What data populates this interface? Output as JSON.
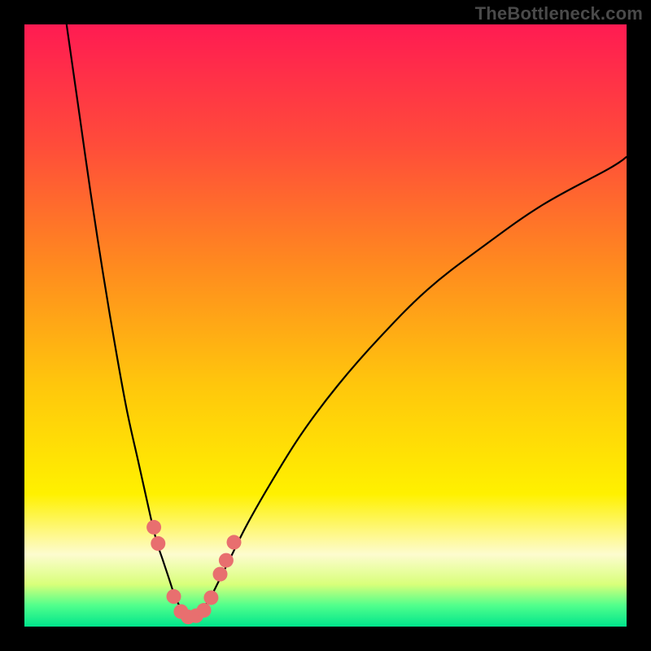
{
  "watermark": "TheBottleneck.com",
  "chart_data": {
    "type": "line",
    "title": "",
    "xlabel": "",
    "ylabel": "",
    "xlim": [
      0,
      100
    ],
    "ylim": [
      0,
      100
    ],
    "minimum_x": 27,
    "green_band": {
      "y0": 0,
      "y1": 4
    },
    "pale_yellow_band": {
      "y0": 4,
      "y1": 14
    },
    "gradient_stops": [
      {
        "t": 0.0,
        "color": "#ff1b52"
      },
      {
        "t": 0.2,
        "color": "#ff4c3a"
      },
      {
        "t": 0.4,
        "color": "#ff8a1f"
      },
      {
        "t": 0.6,
        "color": "#ffc70c"
      },
      {
        "t": 0.78,
        "color": "#fff100"
      },
      {
        "t": 0.88,
        "color": "#fdfccf"
      },
      {
        "t": 0.93,
        "color": "#d8ff7a"
      },
      {
        "t": 0.965,
        "color": "#50ff8c"
      },
      {
        "t": 1.0,
        "color": "#00e58c"
      }
    ],
    "series": [
      {
        "name": "left-branch",
        "x": [
          7,
          9,
          11,
          13,
          15,
          17,
          19,
          21,
          22,
          23,
          24,
          25,
          26,
          27
        ],
        "y": [
          100,
          86,
          72,
          59,
          47,
          36,
          27,
          18,
          14,
          11,
          8,
          5,
          3,
          1.5
        ]
      },
      {
        "name": "right-branch",
        "x": [
          27,
          28,
          29,
          30,
          31,
          32,
          34,
          37,
          41,
          46,
          52,
          59,
          67,
          76,
          86,
          97,
          100
        ],
        "y": [
          1.5,
          1.8,
          2.5,
          3.5,
          5,
          7,
          11,
          17,
          24,
          32,
          40,
          48,
          56,
          63,
          70,
          76,
          78
        ]
      }
    ],
    "markers": {
      "name": "bottom-points",
      "color": "#e86f6f",
      "radius_px": 9,
      "points": [
        {
          "x": 21.5,
          "y": 16.5
        },
        {
          "x": 22.2,
          "y": 13.8
        },
        {
          "x": 24.8,
          "y": 5.0
        },
        {
          "x": 26.0,
          "y": 2.5
        },
        {
          "x": 27.2,
          "y": 1.6
        },
        {
          "x": 28.5,
          "y": 1.8
        },
        {
          "x": 29.8,
          "y": 2.7
        },
        {
          "x": 31.0,
          "y": 4.8
        },
        {
          "x": 32.5,
          "y": 8.7
        },
        {
          "x": 33.5,
          "y": 11.0
        },
        {
          "x": 34.8,
          "y": 14.0
        }
      ]
    }
  }
}
